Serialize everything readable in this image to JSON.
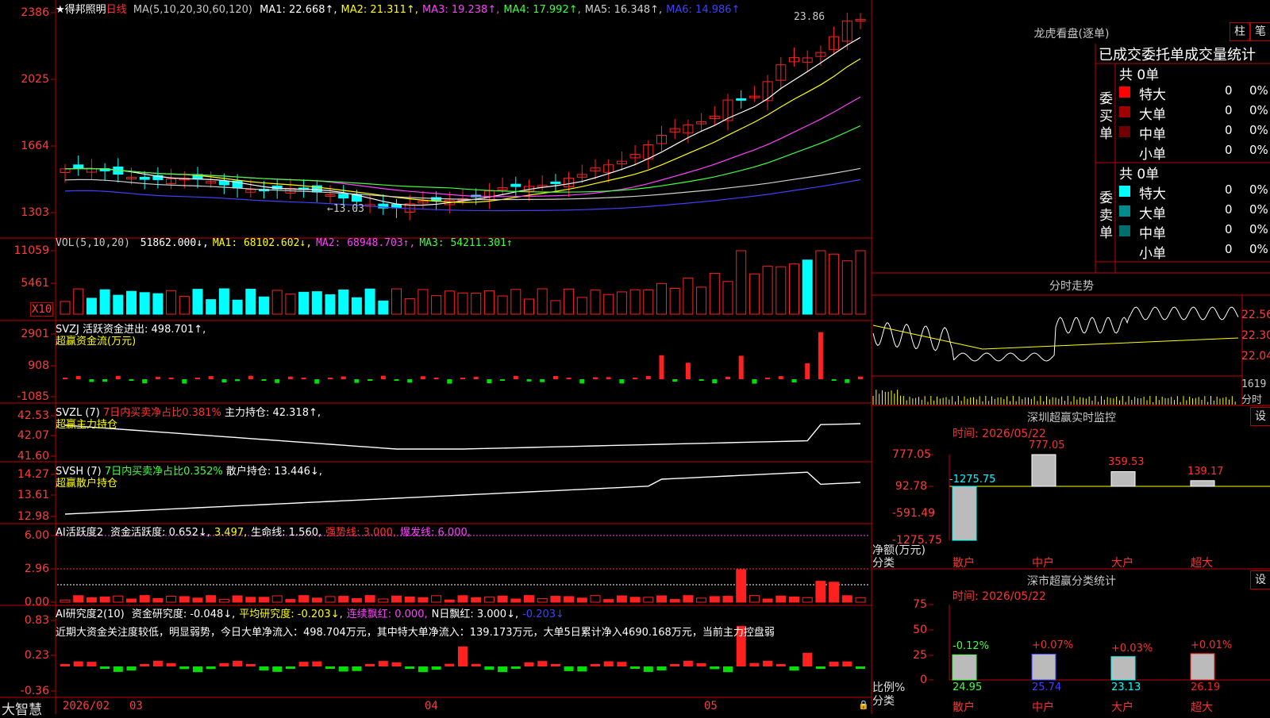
{
  "stock": {
    "name": "★得邦照明",
    "period": "日线"
  },
  "ma_header": {
    "params": "MA(5,10,20,30,60,120)",
    "items": [
      {
        "label": "MA1: 22.668↑,",
        "color": "#ffffff"
      },
      {
        "label": "MA2: 21.311↑,",
        "color": "#ffff00"
      },
      {
        "label": "MA3: 19.238↑,",
        "color": "#ff40ff"
      },
      {
        "label": "MA4: 17.992↑,",
        "color": "#40ff40"
      },
      {
        "label": "MA5: 16.348↑,",
        "color": "#d0d0d0"
      },
      {
        "label": "MA6: 14.986↑",
        "color": "#4040ff"
      }
    ]
  },
  "price_axis": [
    "2386",
    "2025",
    "1664",
    "1303"
  ],
  "price_annotations": {
    "high": "23.86",
    "low": "13.03"
  },
  "vol_header": {
    "params": "VOL(5,10,20)",
    "items": [
      {
        "label": "51862.000↓,",
        "color": "#ffffff"
      },
      {
        "label": "MA1: 68102.602↓,",
        "color": "#ffff00"
      },
      {
        "label": "MA2: 68948.703↑,",
        "color": "#ff40ff"
      },
      {
        "label": "MA3: 54211.301↑",
        "color": "#40ff40"
      }
    ]
  },
  "vol_axis": [
    "11059",
    "5461"
  ],
  "vol_unit": "X10",
  "svzj": {
    "line1": "SVZJ  活跃资金进出: 498.701↑,",
    "line2": "超赢资金流(万元)",
    "axis": [
      "2901",
      "908",
      "-1085"
    ]
  },
  "svzl": {
    "name": "SVZL (7)",
    "pct": "7日内买卖净占比0.381%",
    "hold": "主力持仓: 42.318↑,",
    "line2": "超赢主力持仓",
    "axis": [
      "42.53",
      "42.07",
      "41.60"
    ]
  },
  "svsh": {
    "name": "SVSH (7)",
    "pct": "7日内买卖净占比0.352%",
    "hold": "散户持仓: 13.446↓,",
    "line2": "超赢散户持仓",
    "axis": [
      "14.27",
      "13.61",
      "12.98"
    ]
  },
  "ai1": {
    "name": "AI活跃度2",
    "items": [
      {
        "label": "资金活跃度: 0.652↓,",
        "color": "#ffffff"
      },
      {
        "label": "3.497,",
        "color": "#ffff00"
      },
      {
        "label": "生命线: 1.560,",
        "color": "#ffffff"
      },
      {
        "label": "强势线: 3.000,",
        "color": "#ff3030"
      },
      {
        "label": "爆发线: 6.000,",
        "color": "#ff40ff"
      }
    ],
    "axis": [
      "6.00",
      "2.96",
      "0.00"
    ]
  },
  "ai2": {
    "name": "AI研究度2(10)",
    "items": [
      {
        "label": "资金研究度: -0.048↓,",
        "color": "#ffffff"
      },
      {
        "label": "平均研究度: -0.203↓,",
        "color": "#ffff00"
      },
      {
        "label": "连续飘红: 0.000,",
        "color": "#ff40ff"
      },
      {
        "label": "N日飘红: 3.000↓,",
        "color": "#ffffff"
      },
      {
        "label": "-0.203↓",
        "color": "#4040ff"
      }
    ],
    "comment": "近期大资金关注度较低，明显弱势，今日大单净流入：498.704万元，其中特大单净流入：139.173万元，大单5日累计净入4690.168万元，当前主力控盘弱",
    "axis": [
      "0.83",
      "0.23",
      "-0.36"
    ]
  },
  "bottom": {
    "brand": "大智慧",
    "dates": [
      "2026/02",
      "03",
      "04",
      "05"
    ]
  },
  "lhb": {
    "title": "龙虎看盘(逐单)",
    "btn_a": "柱",
    "btn_b": "笔",
    "header": "已成交委托单成交量统计",
    "buy": {
      "side": "委买单",
      "total": "共 0单",
      "rows": [
        {
          "name": "特大",
          "v": "0",
          "p": "0%",
          "color": "#ff0000"
        },
        {
          "name": "大单",
          "v": "0",
          "p": "0%",
          "color": "#a00000"
        },
        {
          "name": "中单",
          "v": "0",
          "p": "0%",
          "color": "#700000"
        },
        {
          "name": "小单",
          "v": "0",
          "p": "0%",
          "color": ""
        }
      ]
    },
    "sell": {
      "side": "委卖单",
      "total": "共 0单",
      "rows": [
        {
          "name": "特大",
          "v": "0",
          "p": "0%",
          "color": "#00ffff"
        },
        {
          "name": "大单",
          "v": "0",
          "p": "0%",
          "color": "#008c8c"
        },
        {
          "name": "中单",
          "v": "0",
          "p": "0%",
          "color": "#006c6c"
        },
        {
          "name": "小单",
          "v": "0",
          "p": "0%",
          "color": ""
        }
      ]
    }
  },
  "intraday": {
    "title": "分时走势",
    "axis": [
      "22.56",
      "22.30",
      "22.04"
    ],
    "vol": "1619",
    "vol_unit": "分时"
  },
  "monitor": {
    "title": "深圳超赢实时监控",
    "btn": "设",
    "time": "时间: 2026/05/22",
    "axis": [
      "777.05",
      "92.78",
      "-591.49",
      "-1275.75"
    ],
    "unit_label": "净额(万元)",
    "cat_label": "分类",
    "chart_data": {
      "type": "bar",
      "categories": [
        "散户",
        "中户",
        "大户",
        "超大"
      ],
      "values": [
        -1275.75,
        777.05,
        359.53,
        139.17
      ],
      "ylim": [
        -1275.75,
        777.05
      ]
    }
  },
  "classify": {
    "title": "深市超赢分类统计",
    "btn": "设",
    "time": "时间: 2026/05/22",
    "axis": [
      "75",
      "50",
      "25",
      "0"
    ],
    "unit_label": "比例%",
    "cat_label": "分类",
    "chart_data": {
      "type": "bar",
      "categories": [
        "散户",
        "中户",
        "大户",
        "超大"
      ],
      "values": [
        24.95,
        25.74,
        23.13,
        26.19
      ],
      "changes": [
        "-0.12%",
        "+0.07%",
        "+0.03%",
        "+0.01%"
      ],
      "ylim": [
        0,
        75
      ]
    }
  },
  "colors": {
    "up": "#ff2020",
    "down": "#00ffff",
    "border": "#c00000",
    "axis": "#ff3c3c"
  }
}
